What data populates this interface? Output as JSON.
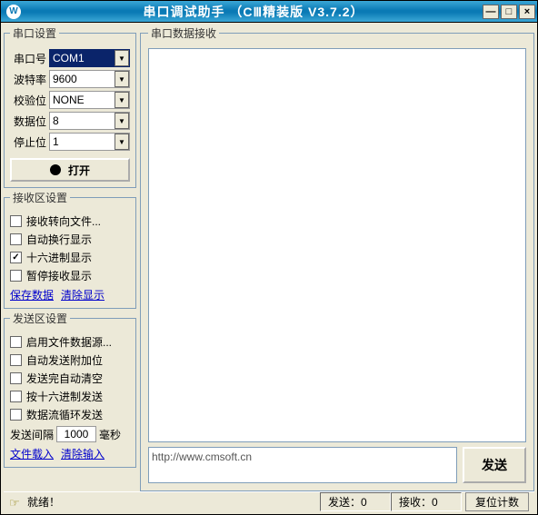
{
  "window": {
    "title": "串口调试助手 （CⅢ精装版 V3.7.2）"
  },
  "serial_settings": {
    "legend": "串口设置",
    "port_label": "串口号",
    "port_value": "COM1",
    "baud_label": "波特率",
    "baud_value": "9600",
    "parity_label": "校验位",
    "parity_value": "NONE",
    "databits_label": "数据位",
    "databits_value": "8",
    "stopbits_label": "停止位",
    "stopbits_value": "1",
    "open_btn": "打开"
  },
  "recv_settings": {
    "legend": "接收区设置",
    "to_file": "接收转向文件...",
    "auto_wrap": "自动换行显示",
    "hex": "十六进制显示",
    "pause": "暂停接收显示",
    "save_link": "保存数据",
    "clear_link": "清除显示"
  },
  "send_settings": {
    "legend": "发送区设置",
    "file_src": "启用文件数据源...",
    "auto_append": "自动发送附加位",
    "clear_after": "发送完自动清空",
    "hex_send": "按十六进制发送",
    "loop_send": "数据流循环发送",
    "interval_label": "发送间隔",
    "interval_value": "1000",
    "interval_unit": "毫秒",
    "load_file_link": "文件载入",
    "clear_input_link": "清除输入"
  },
  "recv_area": {
    "legend": "串口数据接收"
  },
  "send_area": {
    "text": "http://www.cmsoft.cn",
    "button": "发送"
  },
  "status": {
    "ready": "就绪！",
    "sent_label": "发送：",
    "sent_count": "0",
    "recv_label": "接收：",
    "recv_count": "0",
    "reset": "复位计数"
  }
}
